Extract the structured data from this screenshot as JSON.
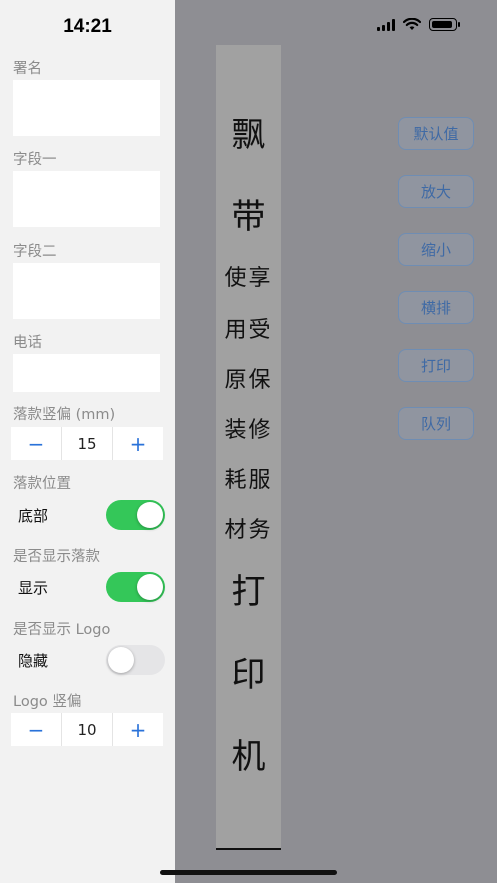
{
  "status": {
    "time": "14:21"
  },
  "form": {
    "signature_label": "署名",
    "field1_label": "字段一",
    "field2_label": "字段二",
    "phone_label": "电话",
    "offset_label": "落款竖偏 (mm)",
    "offset_value": "15",
    "position_label": "落款位置",
    "position_value": "底部",
    "position_on": true,
    "show_sign_label": "是否显示落款",
    "show_sign_value": "显示",
    "show_sign_on": true,
    "show_logo_label": "是否显示 Logo",
    "show_logo_value": "隐藏",
    "show_logo_on": false,
    "logo_offset_label": "Logo 竖偏",
    "logo_offset_value": "10",
    "minus": "−",
    "plus": "+"
  },
  "preview": {
    "big_top": [
      "飘",
      "带"
    ],
    "pairs": [
      "使享",
      "用受",
      "原保",
      "装修",
      "耗服",
      "材务"
    ],
    "big_bottom": [
      "打",
      "印",
      "机"
    ]
  },
  "actions": {
    "default": "默认值",
    "zoom_in": "放大",
    "zoom_out": "缩小",
    "horizontal": "横排",
    "print": "打印",
    "queue": "队列"
  },
  "colors": {
    "switch_on": "#34c759",
    "switch_off": "#e5e5e7",
    "accent": "#2a72d9"
  }
}
